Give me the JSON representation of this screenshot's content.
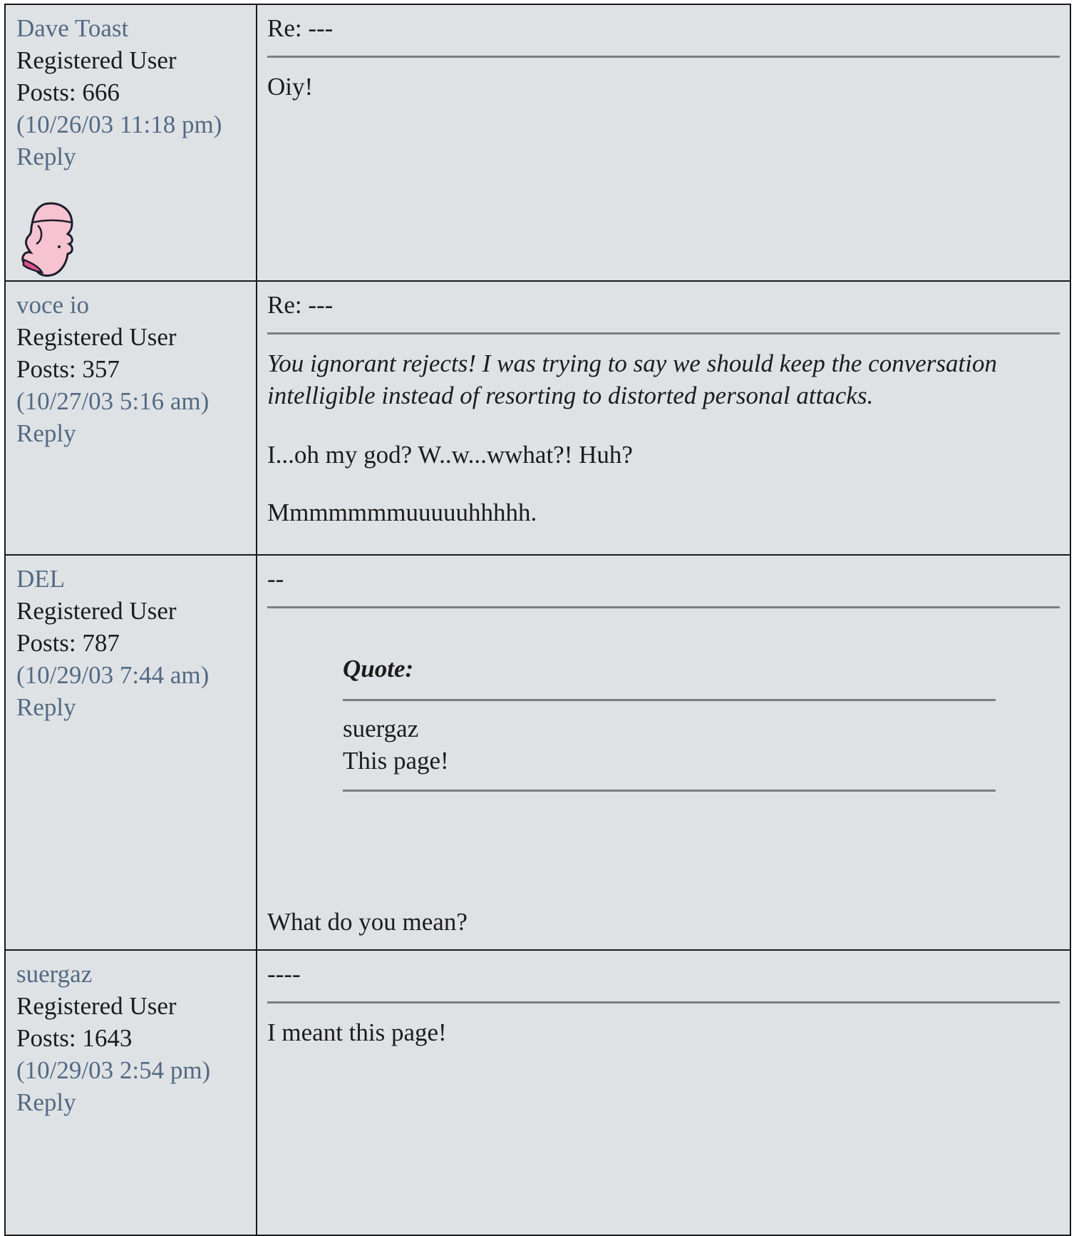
{
  "posts": [
    {
      "username": "Dave Toast",
      "role": "Registered User",
      "posts_label": "Posts: 666",
      "timestamp": "(10/26/03 11:18 pm)",
      "reply_label": "Reply",
      "has_avatar": true,
      "subject": "Re: ---",
      "body": [
        "Oiy!"
      ]
    },
    {
      "username": "voce io",
      "role": "Registered User",
      "posts_label": "Posts: 357",
      "timestamp": "(10/27/03 5:16 am)",
      "reply_label": "Reply",
      "subject": "Re: ---",
      "italic_text": "You ignorant rejects! I was trying to say we should keep the conversation intelligible instead of resorting to distorted personal attacks.",
      "body": [
        "I...oh my god? W..w...wwhat?! Huh?",
        "Mmmmmmmuuuuuhhhhh."
      ]
    },
    {
      "username": "DEL",
      "role": "Registered User",
      "posts_label": "Posts: 787",
      "timestamp": "(10/29/03 7:44 am)",
      "reply_label": "Reply",
      "subject": "--",
      "quote": {
        "header": "Quote:",
        "author": "suergaz",
        "text": "This page!"
      },
      "body": [
        "What do you mean?"
      ]
    },
    {
      "username": "suergaz",
      "role": "Registered User",
      "posts_label": "Posts: 1643",
      "timestamp": "(10/29/03 2:54 pm)",
      "reply_label": "Reply",
      "subject": "----",
      "body": [
        "I meant this page!"
      ]
    }
  ],
  "colors": {
    "link": "#536a83",
    "cell_background": "#dfe2e5",
    "border": "#1a1a1a",
    "rule": "#7b7e82"
  },
  "icons": {
    "avatar_0": "pink-cartoon-head-icon"
  }
}
